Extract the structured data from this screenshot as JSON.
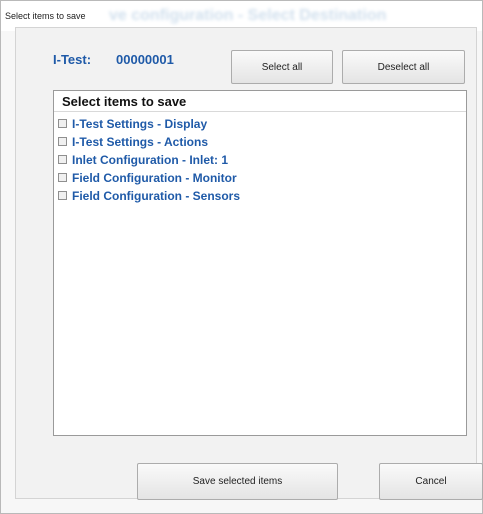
{
  "window": {
    "title": "Select items to save",
    "background_title": "ve configuration - Select Destination"
  },
  "header": {
    "itest_label": "I-Test:",
    "itest_value": "00000001"
  },
  "buttons": {
    "select_all": "Select all",
    "deselect_all": "Deselect all",
    "save_selected": "Save selected items",
    "cancel": "Cancel"
  },
  "list": {
    "header": "Select items to save",
    "items": [
      {
        "label": "I-Test Settings - Display",
        "checked": false
      },
      {
        "label": "I-Test Settings - Actions",
        "checked": false
      },
      {
        "label": "Inlet Configuration - Inlet: 1",
        "checked": false
      },
      {
        "label": "Field Configuration - Monitor",
        "checked": false
      },
      {
        "label": "Field Configuration - Sensors",
        "checked": false
      }
    ]
  },
  "colors": {
    "accent_text": "#1f5aa8",
    "window_background": "#f7f7f7"
  }
}
